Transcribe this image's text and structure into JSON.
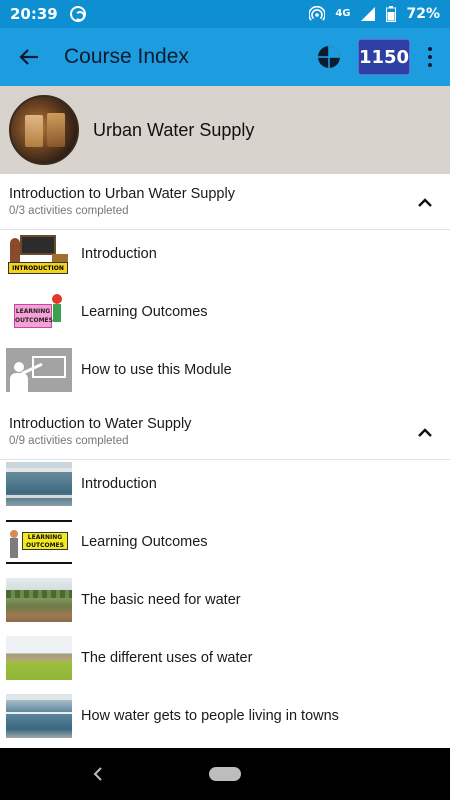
{
  "status_bar": {
    "time": "20:39",
    "network": "4G",
    "battery": "72%",
    "icons": [
      "sync-icon",
      "hotspot-icon",
      "cell-signal-icon",
      "battery-icon"
    ]
  },
  "app_bar": {
    "title": "Course Index",
    "points": "1150",
    "back_icon": "arrow-back-icon",
    "progress_icon": "pie-chart-icon",
    "menu_icon": "more-vert-icon"
  },
  "course": {
    "name": "Urban Water Supply"
  },
  "sections": [
    {
      "title": "Introduction to Urban Water Supply",
      "progress": "0/3 activities completed",
      "activities": [
        {
          "label": "Introduction"
        },
        {
          "label": "Learning Outcomes"
        },
        {
          "label": "How to use this Module"
        }
      ]
    },
    {
      "title": "Introduction to Water Supply",
      "progress": "0/9 activities completed",
      "activities": [
        {
          "label": "Introduction"
        },
        {
          "label": "Learning Outcomes"
        },
        {
          "label": "The basic need for water"
        },
        {
          "label": "The different uses of water"
        },
        {
          "label": "How water gets to people living in towns"
        }
      ]
    }
  ],
  "thumb_text": {
    "intro_banner": "INTRODUCTION",
    "lo_banner": "LEARNING OUTCOMES"
  },
  "colors": {
    "status_bar": "#0e8fd1",
    "app_bar": "#1e9ce0",
    "points_badge": "#2d3fa2",
    "course_header": "#d9d3ce"
  }
}
